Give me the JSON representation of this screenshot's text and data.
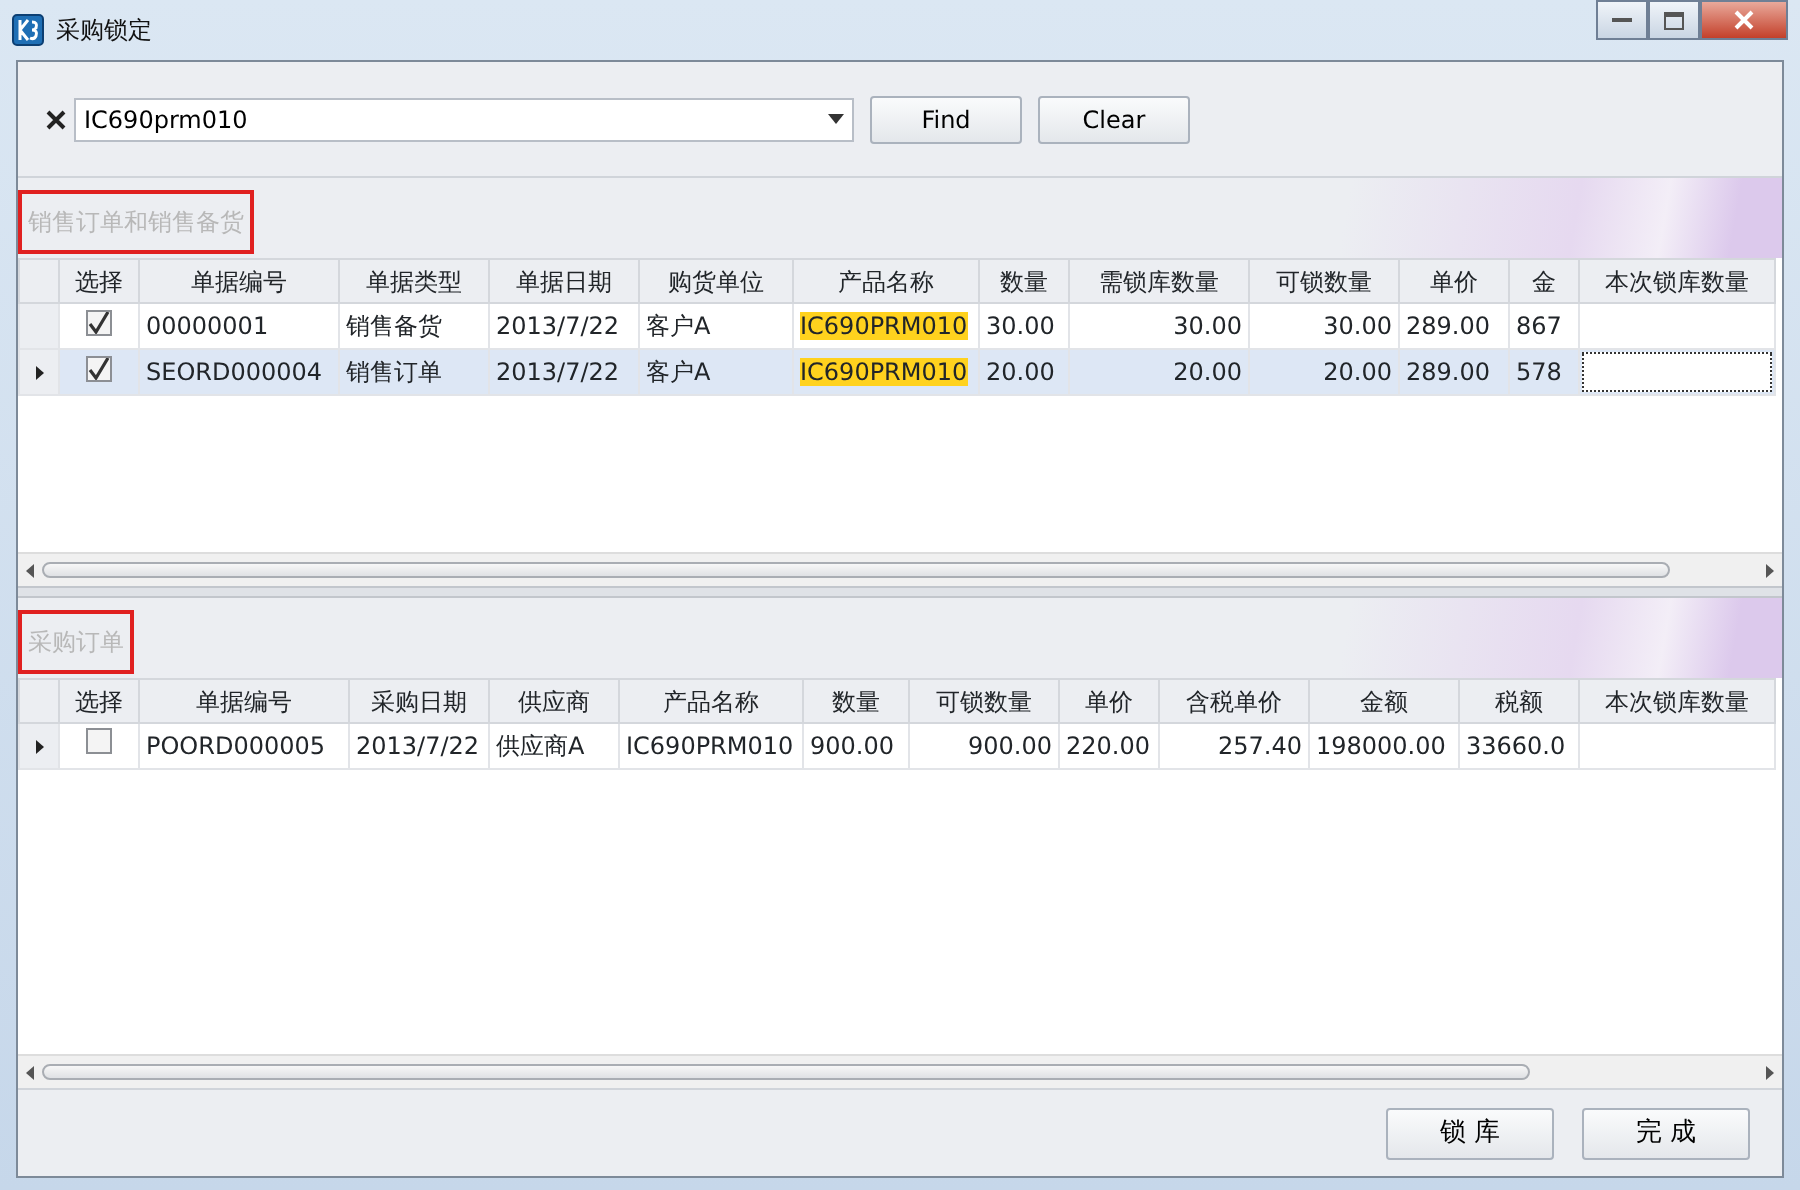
{
  "window": {
    "title": "采购锁定"
  },
  "search": {
    "value": "IC690prm010"
  },
  "search_buttons": [
    "Find",
    "Clear"
  ],
  "sections": [
    {
      "title": "销售订单和销售备货",
      "columns": [
        {
          "label": "选择",
          "kind": "check",
          "highlighted": false
        },
        {
          "label": "单据编号",
          "kind": "text",
          "highlighted": false
        },
        {
          "label": "单据类型",
          "kind": "text",
          "highlighted": false
        },
        {
          "label": "单据日期",
          "kind": "text",
          "highlighted": false
        },
        {
          "label": "购货单位",
          "kind": "text",
          "highlighted": false
        },
        {
          "label": "产品名称",
          "kind": "text",
          "highlighted": true
        },
        {
          "label": "数量",
          "kind": "text",
          "highlighted": false
        },
        {
          "label": "需锁库数量",
          "kind": "number",
          "highlighted": false
        },
        {
          "label": "可锁数量",
          "kind": "number",
          "highlighted": false
        },
        {
          "label": "单价",
          "kind": "text",
          "highlighted": false
        },
        {
          "label": "金",
          "kind": "text",
          "highlighted": false
        },
        {
          "label": "本次锁库数量",
          "kind": "input",
          "highlighted": false
        }
      ],
      "rows": [
        {
          "current": false,
          "selected": false,
          "checked": true,
          "values": [
            "00000001",
            "销售备货",
            "2013/7/22",
            "客户A",
            "IC690PRM010",
            "30.00",
            "30.00",
            "30.00",
            "289.00",
            "867"
          ]
        },
        {
          "current": true,
          "selected": true,
          "checked": true,
          "values": [
            "SEORD000004",
            "销售订单",
            "2013/7/22",
            "客户A",
            "IC690PRM010",
            "20.00",
            "20.00",
            "20.00",
            "289.00",
            "578"
          ]
        }
      ]
    },
    {
      "title": "采购订单",
      "columns": [
        {
          "label": "选择",
          "kind": "check",
          "highlighted": false
        },
        {
          "label": "单据编号",
          "kind": "text",
          "highlighted": false
        },
        {
          "label": "采购日期",
          "kind": "text",
          "highlighted": false
        },
        {
          "label": "供应商",
          "kind": "text",
          "highlighted": false
        },
        {
          "label": "产品名称",
          "kind": "text",
          "highlighted": false
        },
        {
          "label": "数量",
          "kind": "text",
          "highlighted": false
        },
        {
          "label": "可锁数量",
          "kind": "number",
          "highlighted": false
        },
        {
          "label": "单价",
          "kind": "text",
          "highlighted": false
        },
        {
          "label": "含税单价",
          "kind": "number",
          "highlighted": false
        },
        {
          "label": "金额",
          "kind": "text",
          "highlighted": false
        },
        {
          "label": "税额",
          "kind": "text",
          "highlighted": false
        },
        {
          "label": "本次锁库数量",
          "kind": "input",
          "highlighted": false
        }
      ],
      "rows": [
        {
          "current": true,
          "selected": false,
          "checked": false,
          "values": [
            "POORD000005",
            "2013/7/22",
            "供应商A",
            "IC690PRM010",
            "900.00",
            "900.00",
            "220.00",
            "257.40",
            "198000.00",
            "33660.0"
          ]
        }
      ]
    }
  ],
  "footer_buttons": [
    "锁 库",
    "完 成"
  ]
}
